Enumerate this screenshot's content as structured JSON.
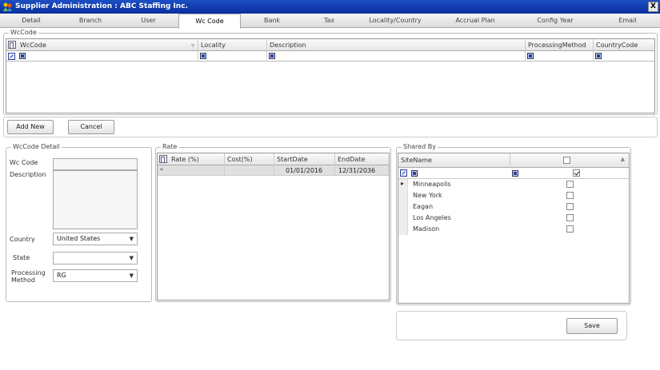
{
  "window": {
    "title": "Supplier Administration : ABC Staffing Inc.",
    "close_label": "X"
  },
  "tabs": [
    {
      "label": "Detail"
    },
    {
      "label": "Branch"
    },
    {
      "label": "User"
    },
    {
      "label": "Wc Code"
    },
    {
      "label": "Bank"
    },
    {
      "label": "Tax"
    },
    {
      "label": "Locality/Country"
    },
    {
      "label": "Accrual Plan"
    },
    {
      "label": "Config Year"
    },
    {
      "label": "Email"
    }
  ],
  "wccode_section": {
    "legend": "WcCode",
    "columns": [
      "WcCode",
      "Locality",
      "Description",
      "ProcessingMethod",
      "CountryCode"
    ]
  },
  "actions": {
    "add_new": "Add New",
    "cancel": "Cancel"
  },
  "detail": {
    "legend": "WcCode Detail",
    "wc_code_label": "Wc Code",
    "description_label": "Description",
    "country_label": "Country",
    "country_value": "United States",
    "state_label": "State",
    "state_value": "",
    "processing_label_1": "Processing",
    "processing_label_2": "Method",
    "processing_value": "RG"
  },
  "rate": {
    "legend": "Rate",
    "columns": [
      "Rate (%)",
      "Cost(%)",
      "StartDate",
      "EndDate"
    ],
    "row": {
      "marker": "*",
      "rate": "",
      "cost": "",
      "start": "01/01/2016",
      "end": "12/31/2036"
    }
  },
  "shared": {
    "legend": "Shared By",
    "col_site": "SiteName",
    "sites": [
      {
        "name": "Minneapolis",
        "checked": false
      },
      {
        "name": "New York",
        "checked": false
      },
      {
        "name": "Eagan",
        "checked": false
      },
      {
        "name": "Los Angeles",
        "checked": false
      },
      {
        "name": "Madison",
        "checked": false
      }
    ]
  },
  "save_label": "Save"
}
